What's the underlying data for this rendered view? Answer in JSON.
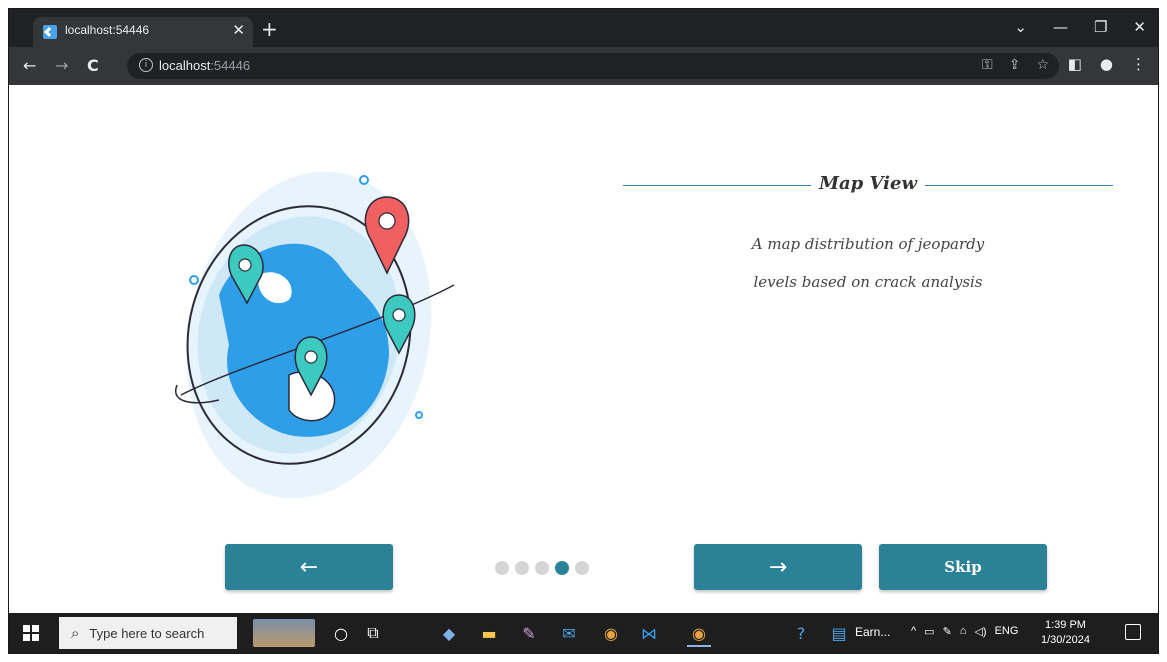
{
  "browser": {
    "tab_title": "localhost:54446",
    "tab_close": "✕",
    "new_tab": "+",
    "window_controls": [
      "⌄",
      "—",
      "❐",
      "✕"
    ],
    "url_host": "localhost",
    "url_port": ":54446",
    "nav_back": "←",
    "nav_forward": "→",
    "nav_reload": "C"
  },
  "page": {
    "title": "Map View",
    "description_line1": "A map distribution of jeopardy",
    "description_line2": "levels based on crack analysis",
    "back_button": "←",
    "next_button": "→",
    "skip_button": "Skip",
    "pagination": {
      "total": 5,
      "active_index": 3
    },
    "accent_color": "#2b8196"
  },
  "taskbar": {
    "search_placeholder": "Type here to search",
    "tray_language": "ENG",
    "time": "1:39 PM",
    "date": "1/30/2024",
    "pinned_app_label": "Earn..."
  }
}
